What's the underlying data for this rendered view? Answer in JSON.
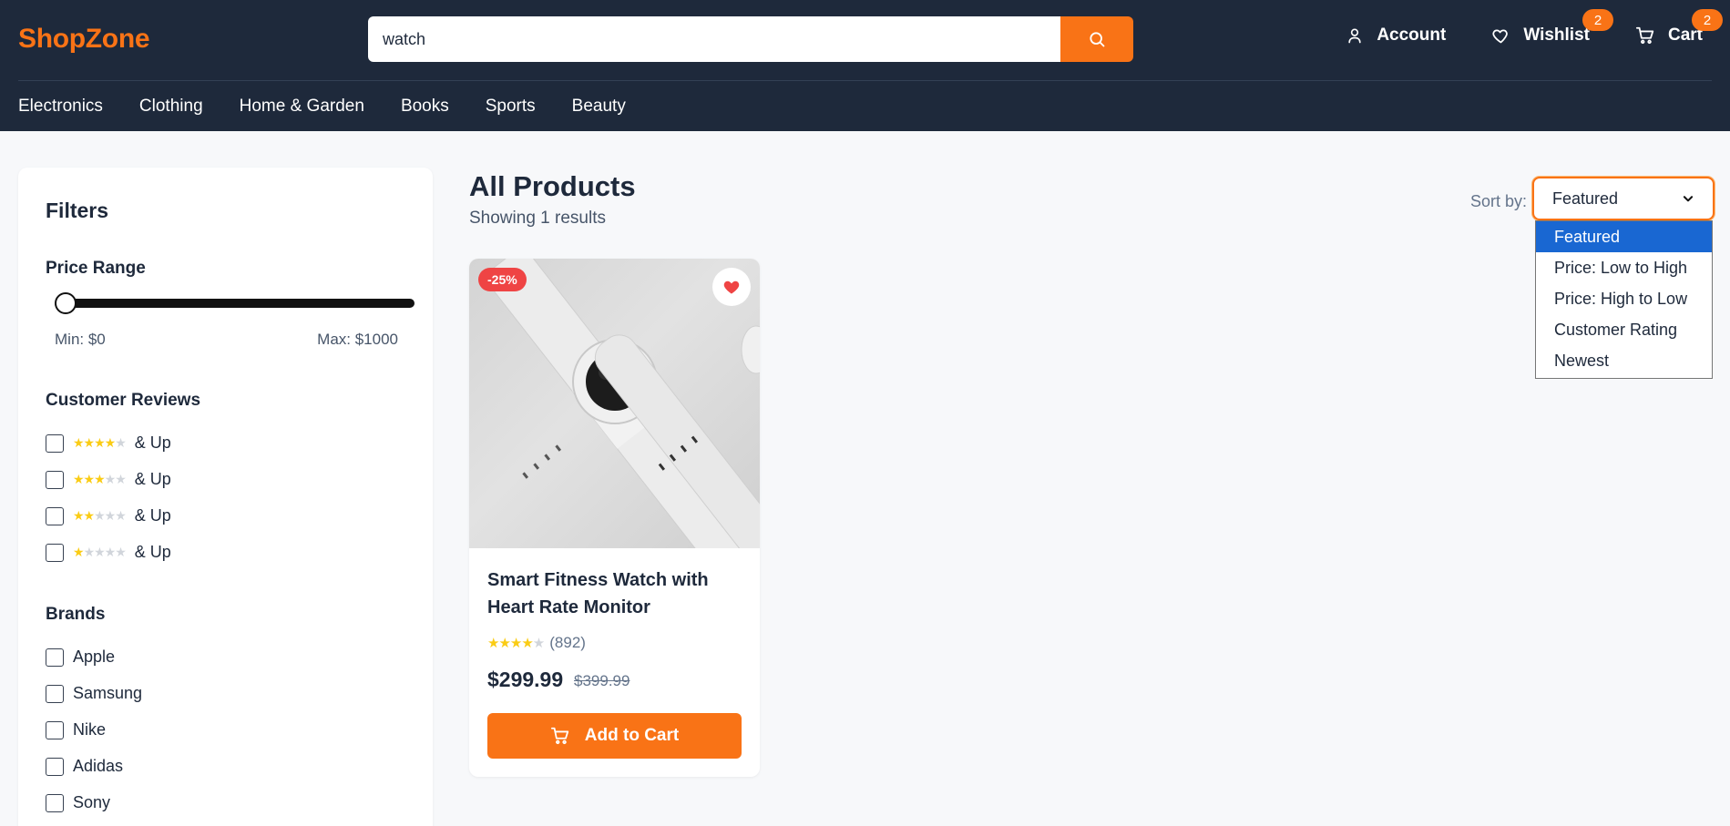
{
  "header": {
    "logo": "ShopZone",
    "search": {
      "value": "watch",
      "placeholder": ""
    },
    "account_label": "Account",
    "wishlist_label": "Wishlist",
    "wishlist_count": "2",
    "cart_label": "Cart",
    "cart_count": "2"
  },
  "nav": [
    "Electronics",
    "Clothing",
    "Home & Garden",
    "Books",
    "Sports",
    "Beauty"
  ],
  "filters": {
    "title": "Filters",
    "price_range": {
      "title": "Price Range",
      "min_label": "Min: $0",
      "max_label": "Max: $1000",
      "slider_value": 0
    },
    "reviews": {
      "title": "Customer Reviews",
      "suffix": "& Up",
      "options": [
        {
          "stars": 4,
          "label": "& Up"
        },
        {
          "stars": 3,
          "label": "& Up"
        },
        {
          "stars": 2,
          "label": "& Up"
        },
        {
          "stars": 1,
          "label": "& Up"
        }
      ]
    },
    "brands": {
      "title": "Brands",
      "items": [
        "Apple",
        "Samsung",
        "Nike",
        "Adidas",
        "Sony"
      ]
    }
  },
  "main": {
    "title": "All Products",
    "results_text": "Showing 1 results",
    "sort": {
      "label": "Sort by:",
      "selected": "Featured",
      "options": [
        "Featured",
        "Price: Low to High",
        "Price: High to Low",
        "Customer Rating",
        "Newest"
      ]
    }
  },
  "product": {
    "discount": "-25%",
    "name": "Smart Fitness Watch with Heart Rate Monitor",
    "rating_stars": 4,
    "reviews": "(892)",
    "price": "$299.99",
    "old_price": "$399.99",
    "add_to_cart": "Add to Cart"
  },
  "colors": {
    "header_bg": "#1e293b",
    "accent": "#f97316",
    "badge": "#ef4444",
    "selected_option": "#1967d2",
    "star": "#facc15"
  },
  "icons": [
    "search-icon",
    "user-icon",
    "heart-icon",
    "cart-icon",
    "chevron-down-icon"
  ]
}
